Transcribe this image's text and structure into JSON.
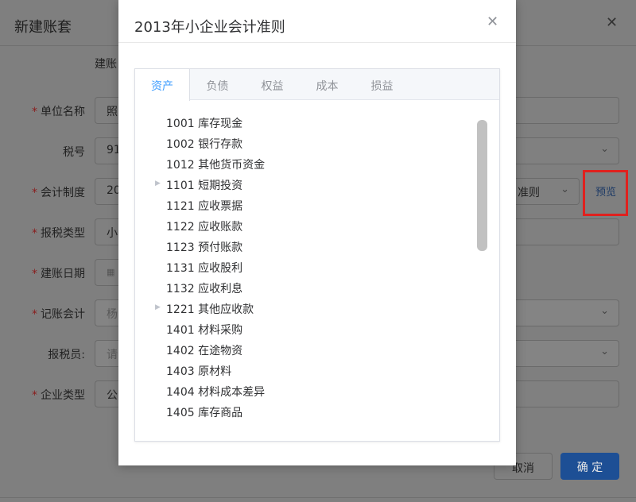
{
  "background_dialog": {
    "title": "新建账套",
    "subheading": "建账",
    "fields": [
      {
        "label": "单位名称",
        "required": true,
        "value": "照",
        "right_value": "",
        "disabled": false
      },
      {
        "label": "税号",
        "required": false,
        "value": "91",
        "right_value": "",
        "disabled": false
      },
      {
        "label": "会计制度",
        "required": true,
        "value": "20",
        "right_value": "准则",
        "disabled": false
      },
      {
        "label": "报税类型",
        "required": true,
        "value": "小",
        "right_value": "",
        "disabled": false
      },
      {
        "label": "建账日期",
        "required": true,
        "value": "",
        "right_value": "",
        "disabled": false
      },
      {
        "label": "记账会计",
        "required": true,
        "value": "杨",
        "right_value": "",
        "disabled": true
      },
      {
        "label": "报税员:",
        "required": false,
        "value": "请",
        "right_value": "",
        "disabled": true
      },
      {
        "label": "企业类型",
        "required": true,
        "value": "公",
        "right_value": "",
        "disabled": false
      }
    ],
    "preview_link": "预览",
    "cancel_label": "取消",
    "ok_label": "确 定"
  },
  "modal": {
    "title": "2013年小企业会计准则",
    "tabs": [
      {
        "label": "资产",
        "active": true
      },
      {
        "label": "负债",
        "active": false
      },
      {
        "label": "权益",
        "active": false
      },
      {
        "label": "成本",
        "active": false
      },
      {
        "label": "损益",
        "active": false
      }
    ],
    "accounts": [
      {
        "label": "1001 库存现金",
        "expandable": false
      },
      {
        "label": "1002 银行存款",
        "expandable": false
      },
      {
        "label": "1012 其他货币资金",
        "expandable": false
      },
      {
        "label": "1101 短期投资",
        "expandable": true
      },
      {
        "label": "1121 应收票据",
        "expandable": false
      },
      {
        "label": "1122 应收账款",
        "expandable": false
      },
      {
        "label": "1123 预付账款",
        "expandable": false
      },
      {
        "label": "1131 应收股利",
        "expandable": false
      },
      {
        "label": "1132 应收利息",
        "expandable": false
      },
      {
        "label": "1221 其他应收款",
        "expandable": true
      },
      {
        "label": "1401 材料采购",
        "expandable": false
      },
      {
        "label": "1402 在途物资",
        "expandable": false
      },
      {
        "label": "1403 原材料",
        "expandable": false
      },
      {
        "label": "1404 材料成本差异",
        "expandable": false
      },
      {
        "label": "1405 库存商品",
        "expandable": false
      }
    ]
  },
  "colors": {
    "accent": "#409eff",
    "highlight_box": "#e0211e"
  }
}
